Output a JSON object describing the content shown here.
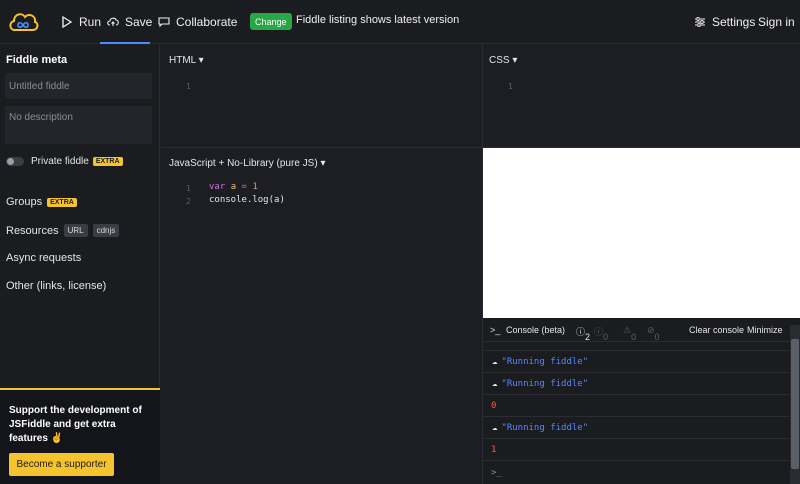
{
  "topbar": {
    "run_label": "Run",
    "save_label": "Save",
    "collaborate_label": "Collaborate",
    "change_badge": "Change",
    "version_message": "Fiddle listing shows latest version",
    "settings_label": "Settings",
    "signin_label": "Sign in"
  },
  "sidebar": {
    "title": "Fiddle meta",
    "title_placeholder": "Untitled fiddle",
    "description_placeholder": "No description",
    "private_label": "Private fiddle",
    "extra_badge": "EXTRA",
    "groups_label": "Groups",
    "resources_label": "Resources",
    "resources_tags": [
      "URL",
      "cdnjs"
    ],
    "async_label": "Async requests",
    "other_label": "Other (links, license)",
    "promo_text": "Support the development of JSFiddle and get extra features ✌",
    "promo_button": "Become a supporter"
  },
  "editors": {
    "html_label": "HTML",
    "css_label": "CSS",
    "js_label": "JavaScript + No-Library (pure JS)",
    "html_line": "1",
    "css_line": "1",
    "js_lines": [
      "1",
      "2"
    ],
    "js_code": {
      "line1_kw": "var",
      "line1_var": "a",
      "line1_op": "=",
      "line1_num": "1",
      "line2": "console.log(a)"
    }
  },
  "console": {
    "title": "Console (beta)",
    "info_count": "2",
    "warn_count": "0",
    "alert_count": "0",
    "error_count": "0",
    "clear_label": "Clear console",
    "minimize_label": "Minimize",
    "entries": [
      {
        "text": "\"Running fiddle\"",
        "kind": "string"
      },
      {
        "text": "\"Running fiddle\"",
        "kind": "string"
      },
      {
        "text": "0",
        "kind": "number"
      },
      {
        "text": "\"Running fiddle\"",
        "kind": "string"
      },
      {
        "text": "1",
        "kind": "number"
      }
    ],
    "prompt": ">_"
  },
  "colors": {
    "accent": "#4a8cff",
    "extra_badge": "#f5c32e",
    "change_badge": "#27a745",
    "string_output": "#5a86ff",
    "number_output": "#ff5a4a"
  }
}
